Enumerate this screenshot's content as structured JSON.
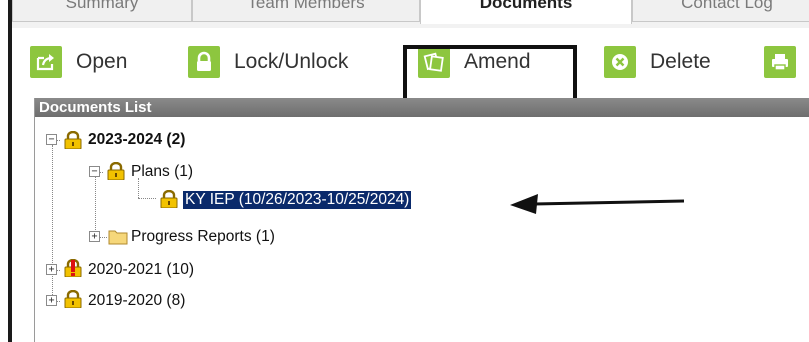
{
  "tabs": [
    {
      "label": "Summary"
    },
    {
      "label": "Team Members"
    },
    {
      "label": "Documents"
    },
    {
      "label": "Contact Log"
    }
  ],
  "toolbar": {
    "open": {
      "label": "Open",
      "icon": "open-external-icon"
    },
    "lock": {
      "label": "Lock/Unlock",
      "icon": "padlock-icon"
    },
    "amend": {
      "label": "Amend",
      "icon": "amend-documents-icon"
    },
    "delete": {
      "label": "Delete",
      "icon": "delete-x-icon"
    },
    "print": {
      "icon": "printer-icon"
    }
  },
  "colors": {
    "button_green": "#8dc63f",
    "selection": "#0a2a6b",
    "header_gray": "#7a7a7a"
  },
  "documents_list": {
    "header": "Documents List",
    "tree": {
      "y2023": {
        "label": "2023-2024 (2)",
        "icon": "lock-icon",
        "expanded": true
      },
      "plans": {
        "label": "Plans (1)",
        "icon": "lock-icon",
        "expanded": true
      },
      "ky_iep": {
        "label": "KY IEP (10/26/2023-10/25/2024)",
        "icon": "lock-icon",
        "selected": true
      },
      "progress": {
        "label": "Progress Reports (1)",
        "icon": "folder-icon",
        "expanded": false
      },
      "y2020": {
        "label": "2020-2021 (10)",
        "icon": "lock-red-alert-icon",
        "expanded": false
      },
      "y2019": {
        "label": "2019-2020 (8)",
        "icon": "lock-icon",
        "expanded": false
      }
    }
  }
}
